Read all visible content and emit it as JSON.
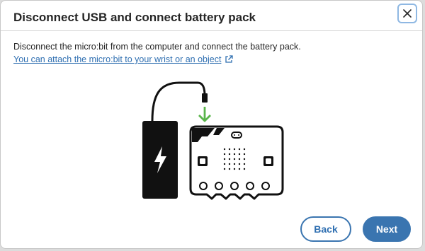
{
  "dialog": {
    "title": "Disconnect USB and connect battery pack",
    "body": "Disconnect the micro:bit from the computer and connect the battery pack.",
    "link": "You can attach the micro:bit to your wrist or an object",
    "icons": {
      "close": "close-icon",
      "external_link": "external-link-icon",
      "battery": "battery-bolt-icon",
      "arrow": "arrow-down-icon"
    }
  },
  "buttons": {
    "back": "Back",
    "next": "Next"
  },
  "colors": {
    "accent": "#3a75b0",
    "link": "#2f6fb1",
    "arrow": "#5ab54b",
    "device": "#111111"
  }
}
